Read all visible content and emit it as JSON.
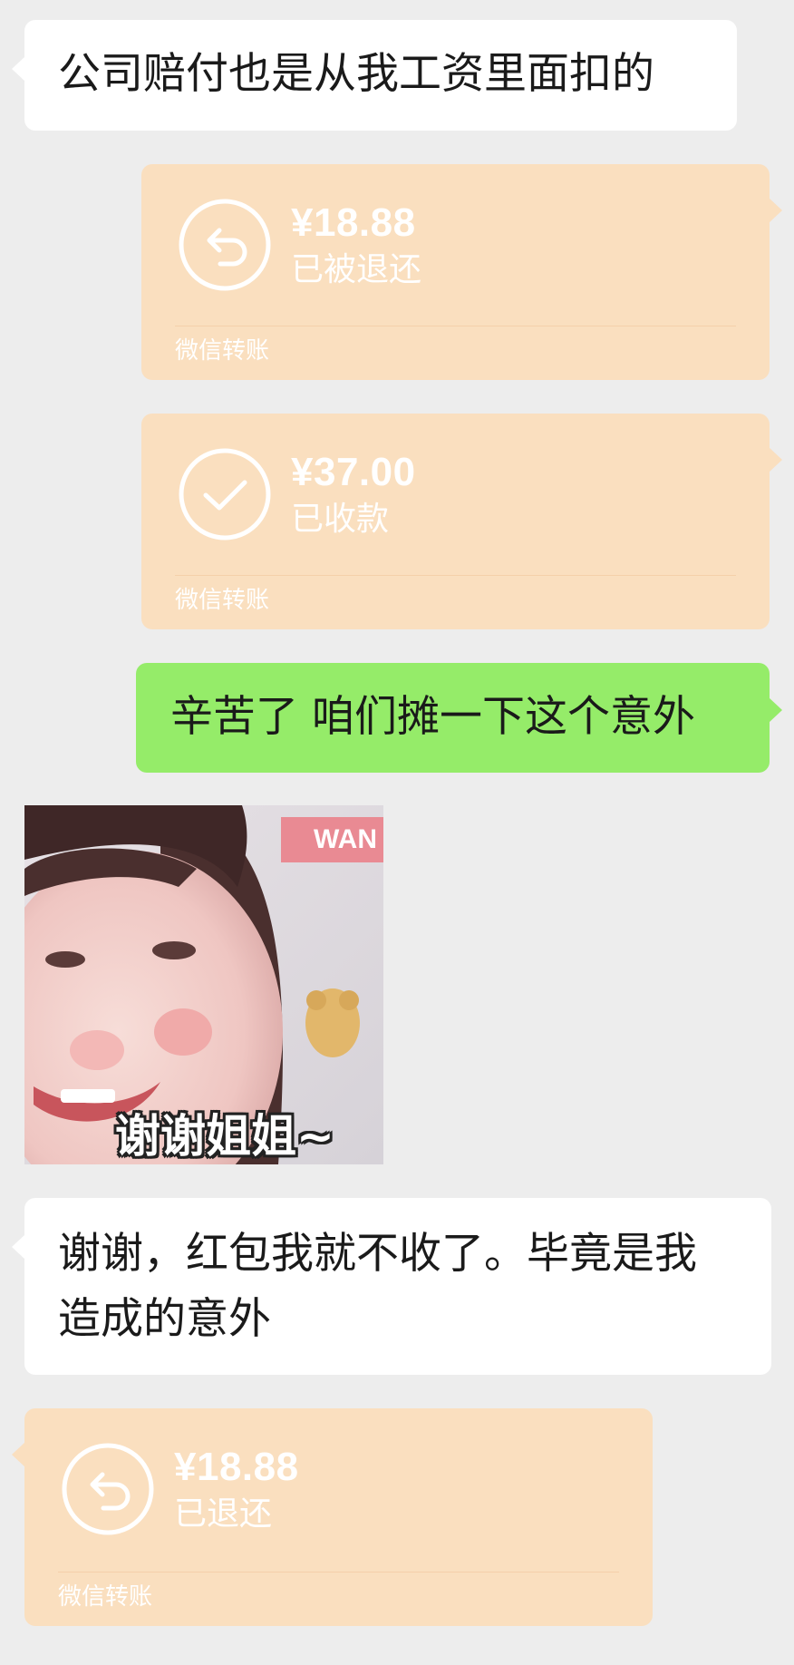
{
  "messages": {
    "m1": {
      "sender": "other",
      "text": "公司赔付也是从我工资里面扣的"
    },
    "m2": {
      "sender": "me",
      "type": "transfer",
      "icon": "return-arrow-icon",
      "amount": "¥18.88",
      "status": "已被退还",
      "footer": "微信转账"
    },
    "m3": {
      "sender": "me",
      "type": "transfer",
      "icon": "checkmark-icon",
      "amount": "¥37.00",
      "status": "已收款",
      "footer": "微信转账"
    },
    "m4": {
      "sender": "me",
      "text": "辛苦了 咱们摊一下这个意外"
    },
    "m5": {
      "sender": "other",
      "type": "sticker",
      "caption": "谢谢姐姐~",
      "watermark": "WAN"
    },
    "m6": {
      "sender": "other",
      "text": "谢谢，红包我就不收了。毕竟是我造成的意外"
    },
    "m7": {
      "sender": "other",
      "type": "transfer",
      "icon": "return-arrow-icon",
      "amount": "¥18.88",
      "status": "已退还",
      "footer": "微信转账"
    }
  },
  "colors": {
    "background": "#ededed",
    "incoming_bubble": "#ffffff",
    "outgoing_bubble": "#95ec69",
    "transfer_card": "#fadfbf"
  }
}
